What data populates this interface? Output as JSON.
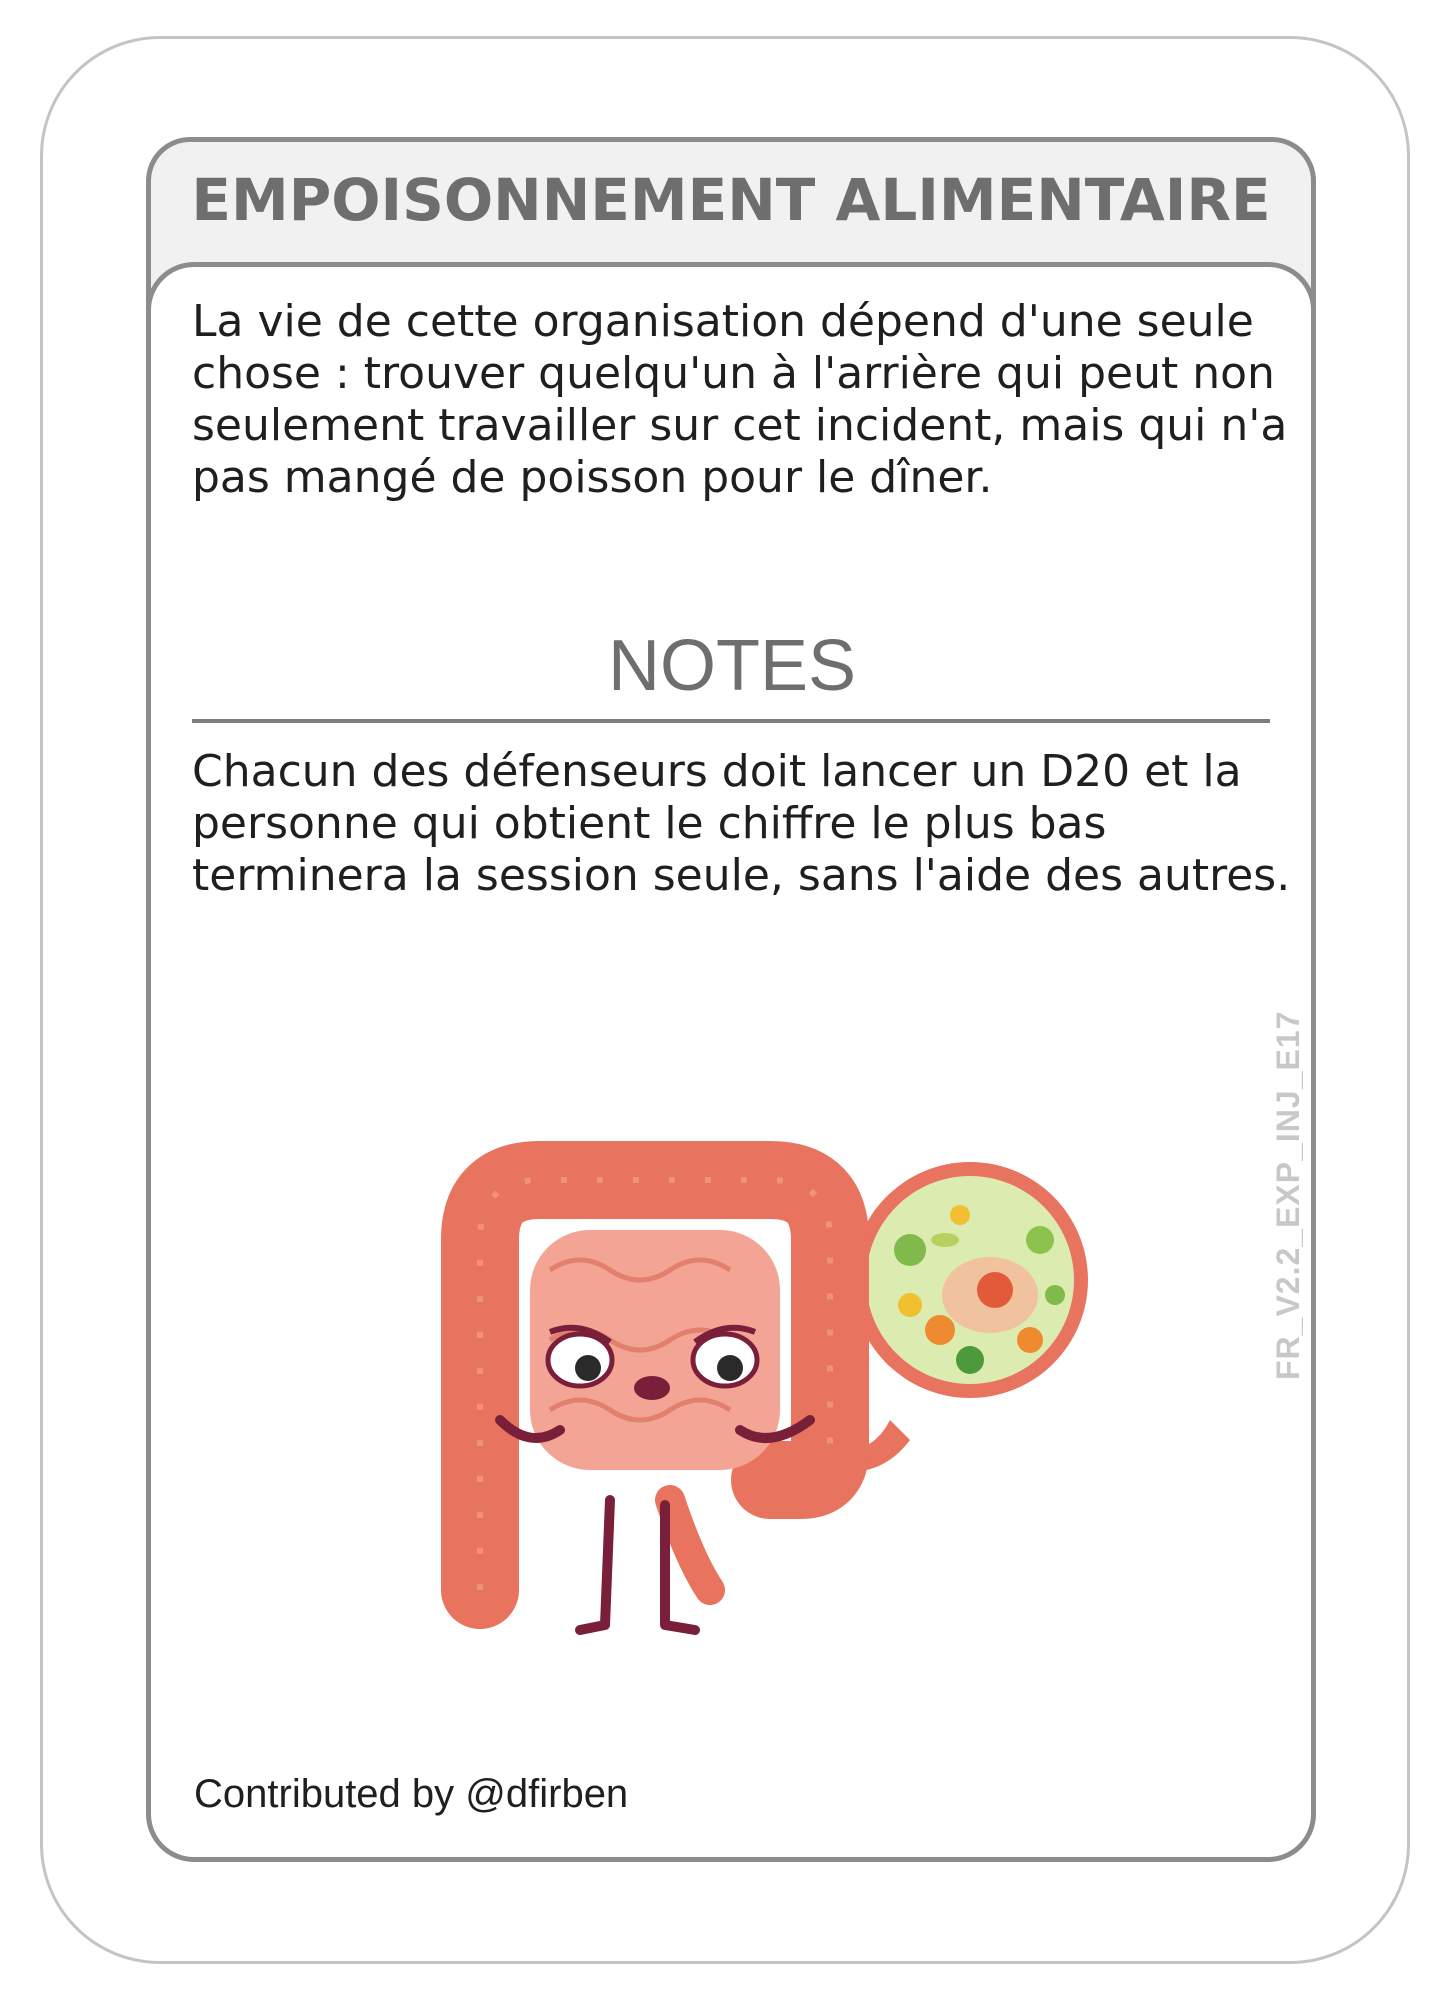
{
  "card": {
    "title": "EMPOISONNEMENT ALIMENTAIRE",
    "description": "La vie de cette organisation dépend d'une seule chose : trouver quelqu'un à l'arrière qui peut non seulement travailler sur cet incident, mais qui n'a pas mangé de poisson pour le dîner.",
    "notes_heading": "NOTES",
    "notes_body": "Chacun des défenseurs doit lancer un D20 et la personne qui obtient le chiffre le plus bas terminera la session seule, sans l'aide des autres.",
    "card_code": "FR_V2.2_EXP_INJ_E17",
    "contributor": "Contributed by @dfirben"
  },
  "illustration": {
    "icon": "sick-intestine-with-bacteria-icon"
  },
  "colors": {
    "border": "#8c8c8c",
    "header_background": "#f1f1f1",
    "title_text": "#6e6e6e",
    "body_text": "#1f1f1f",
    "intestine": "#e8735e",
    "bacteria_bubble": "#dcebb0"
  }
}
